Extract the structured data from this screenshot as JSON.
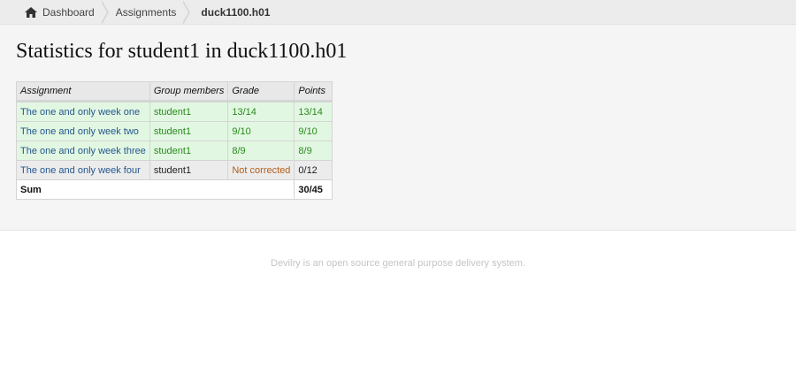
{
  "breadcrumb": {
    "items": [
      {
        "label": "Dashboard",
        "icon": "home-icon"
      },
      {
        "label": "Assignments"
      },
      {
        "label": "duck1100.h01"
      }
    ]
  },
  "page": {
    "title": "Statistics for student1 in duck1100.h01"
  },
  "table": {
    "headers": {
      "assignment": "Assignment",
      "group": "Group members",
      "grade": "Grade",
      "points": "Points"
    },
    "rows": [
      {
        "assignment": "The one and only week one",
        "group": "student1",
        "grade": "13/14",
        "points": "13/14",
        "status": "passed"
      },
      {
        "assignment": "The one and only week two",
        "group": "student1",
        "grade": "9/10",
        "points": "9/10",
        "status": "passed"
      },
      {
        "assignment": "The one and only week three",
        "group": "student1",
        "grade": "8/9",
        "points": "8/9",
        "status": "passed"
      },
      {
        "assignment": "The one and only week four",
        "group": "student1",
        "grade": "Not corrected",
        "points": "0/12",
        "status": "not-corrected"
      }
    ],
    "sum": {
      "label": "Sum",
      "points": "30/45"
    }
  },
  "footer": {
    "text": "Devilry is an open source general purpose delivery system."
  },
  "colors": {
    "passed_bg": "#e2f7e2",
    "passed_text": "#2a8a1e",
    "not_corrected_text": "#b15d1a",
    "link": "#24578f"
  }
}
